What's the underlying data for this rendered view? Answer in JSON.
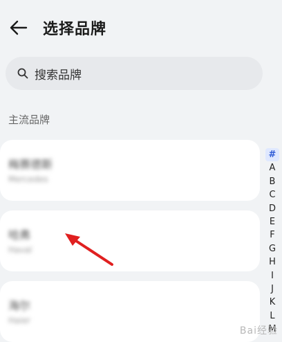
{
  "header": {
    "title": "选择品牌"
  },
  "search": {
    "placeholder": "搜索品牌"
  },
  "section": {
    "label": "主流品牌"
  },
  "brands": [
    {
      "name": "梅赛德斯",
      "sub": "Mercedes"
    },
    {
      "name": "哈弗",
      "sub": "Haval"
    },
    {
      "name": "海尔",
      "sub": "Haier"
    }
  ],
  "index": [
    "#",
    "A",
    "B",
    "C",
    "D",
    "E",
    "F",
    "G",
    "H",
    "I",
    "J",
    "K",
    "L",
    "M"
  ],
  "index_active": "#",
  "watermark": "Bai经验"
}
